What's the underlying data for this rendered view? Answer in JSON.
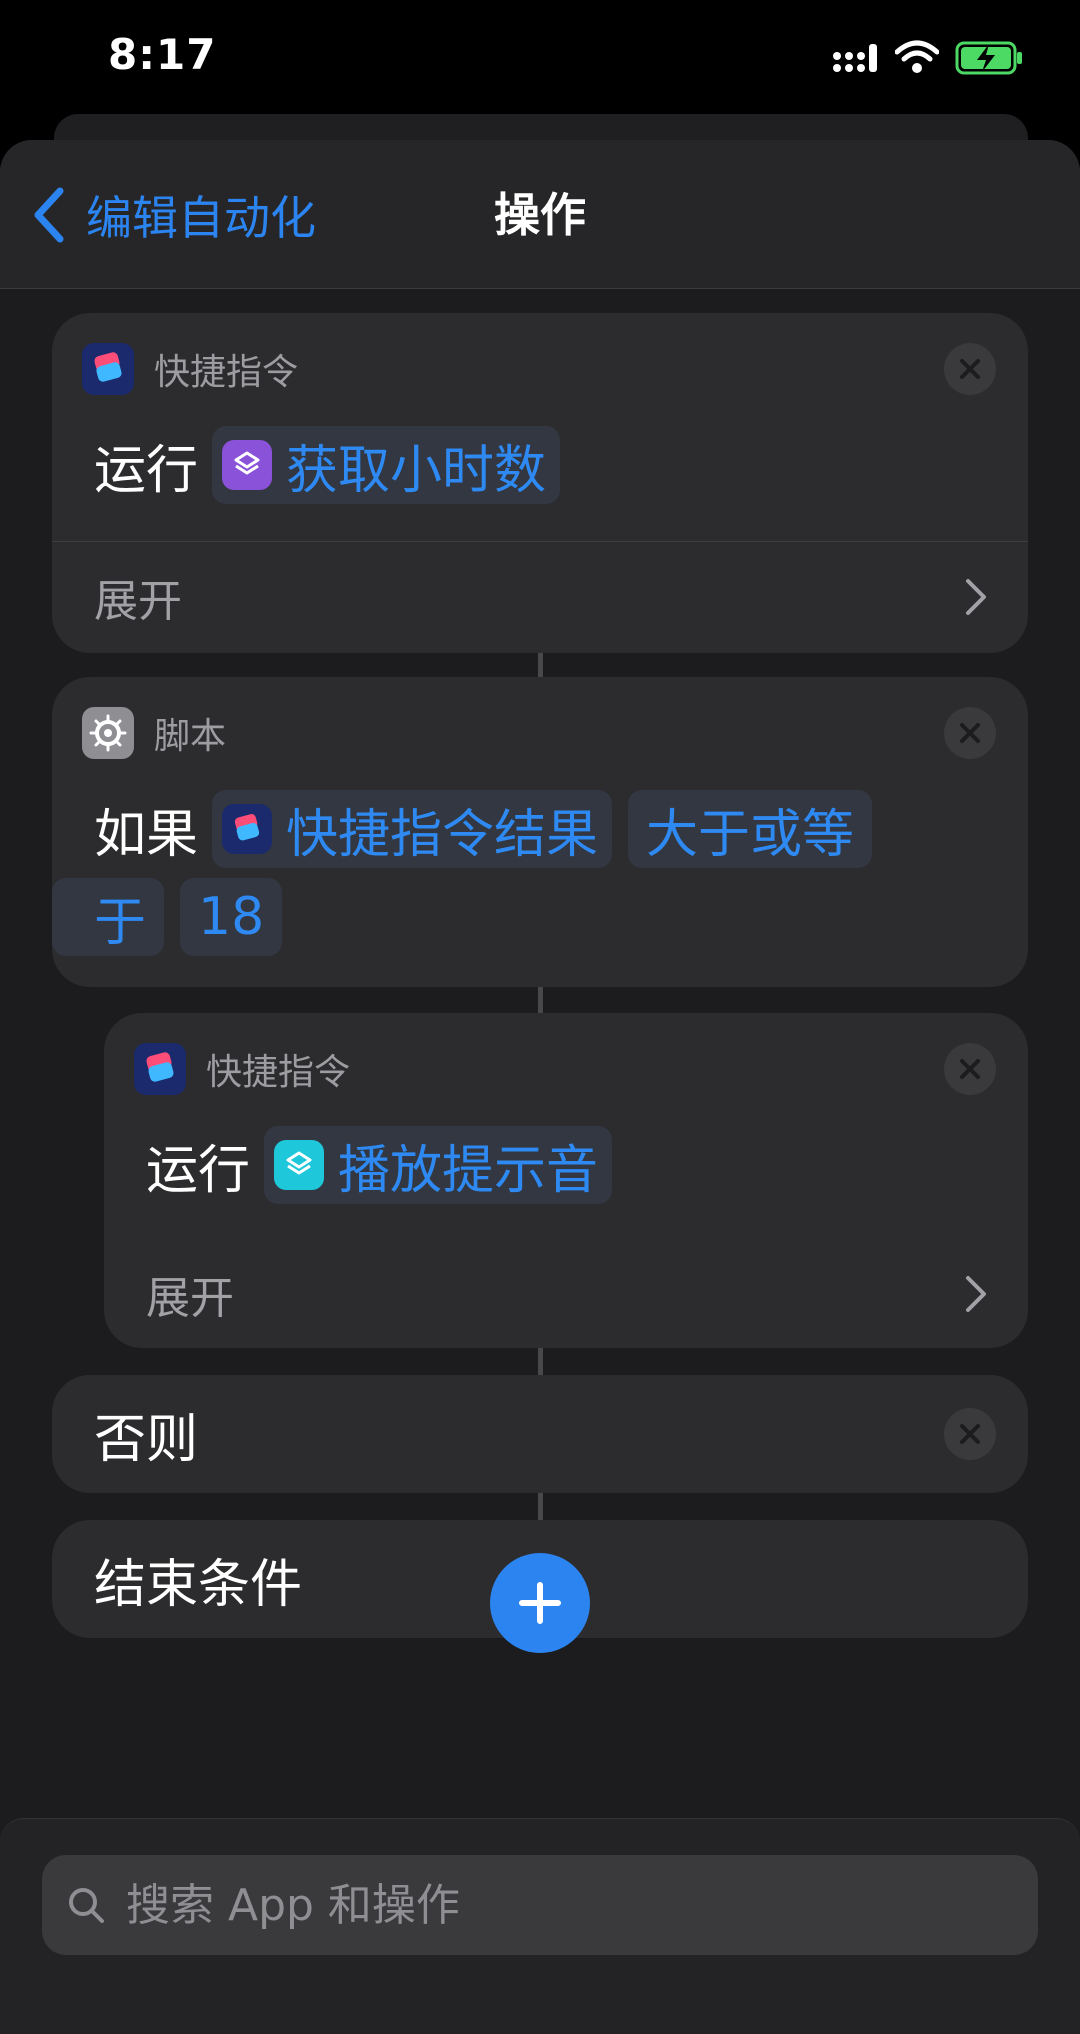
{
  "status_bar": {
    "time": "8:17"
  },
  "nav": {
    "back_label": "编辑自动化",
    "title": "操作"
  },
  "actions": [
    {
      "app_name": "快捷指令",
      "verb": "运行",
      "token_label": "获取小时数",
      "expand_label": "展开"
    },
    {
      "app_name": "脚本",
      "verb": "如果",
      "tokens": [
        "快捷指令结果",
        "大于或等",
        "于",
        "18"
      ]
    },
    {
      "app_name": "快捷指令",
      "verb": "运行",
      "token_label": "播放提示音",
      "expand_label": "展开"
    },
    {
      "label": "否则"
    },
    {
      "label": "结束条件"
    }
  ],
  "search": {
    "placeholder": "搜索 App 和操作"
  },
  "colors": {
    "accent": "#2b84f0",
    "card": "#2c2c2e",
    "sheet": "#1c1c1e",
    "token_bg": "#323741"
  },
  "icons": {
    "back": "chevron-left-icon",
    "close": "close-icon",
    "expand": "chevron-right-icon",
    "add": "plus-icon",
    "search": "magnifier-icon",
    "shortcuts": "shortcuts-app-icon",
    "settings": "gear-icon"
  }
}
